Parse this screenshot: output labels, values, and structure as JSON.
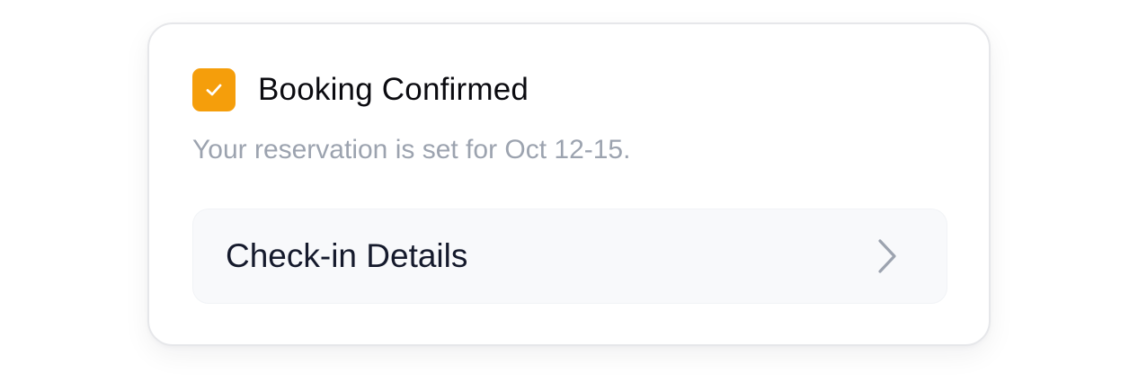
{
  "card": {
    "title": "Booking Confirmed",
    "subtitle": "Your reservation is set for Oct 12-15.",
    "checkbox_checked": true,
    "accent_color": "#f59e0b",
    "details_button": {
      "label": "Check-in Details",
      "icon": "chevron-right-icon"
    }
  }
}
